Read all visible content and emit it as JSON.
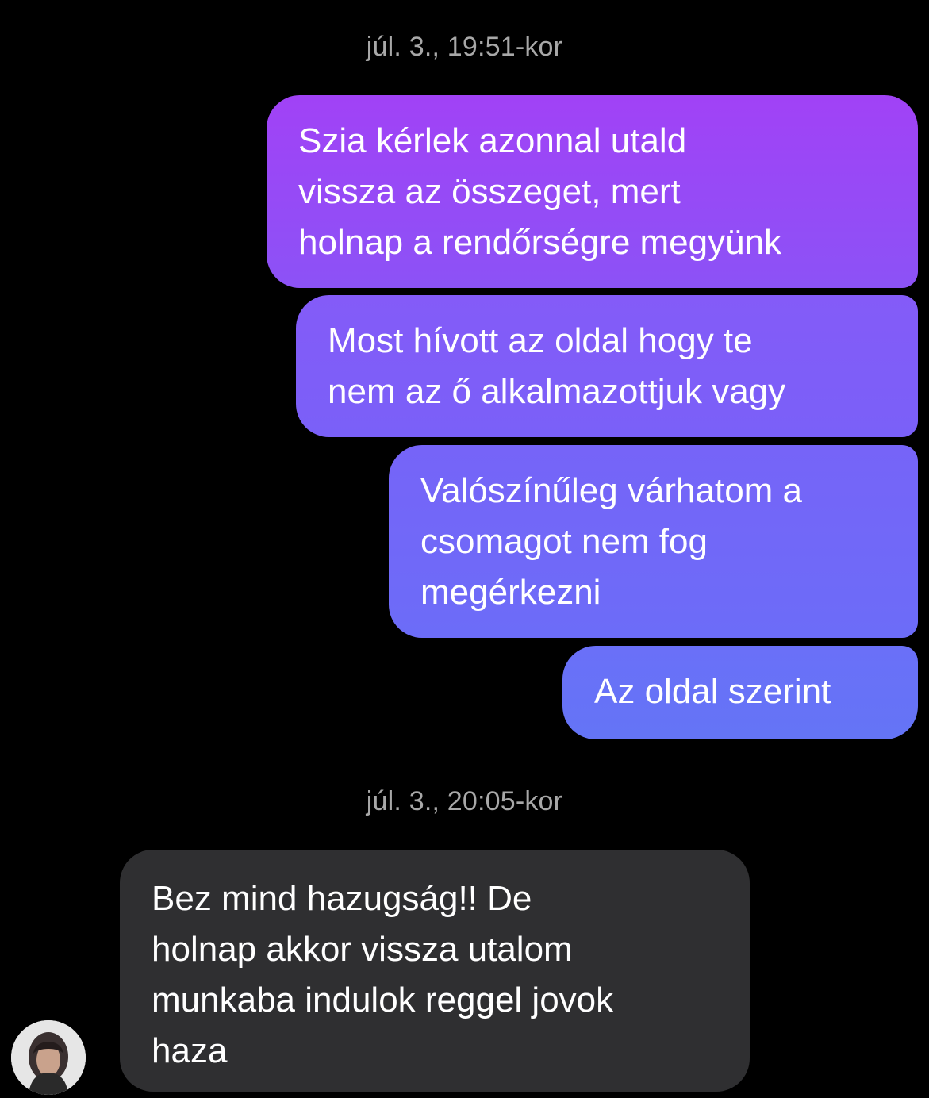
{
  "conversation": {
    "timestamps": [
      "júl. 3., 19:51-kor",
      "júl. 3., 20:05-kor"
    ],
    "outgoing_messages": [
      "Szia kérlek azonnal utald\nvissza az összeget, mert\nholnap a rendőrségre megyünk",
      "Most hívott az oldal hogy te\nnem az ő alkalmazottjuk vagy",
      "Valószínűleg várhatom a\ncsomagot nem fog\nmegérkezni",
      "Az oldal szerint"
    ],
    "incoming_messages": [
      "Bez mind hazugság!! De\nholnap akkor vissza utalom\nmunkaba indulok reggel jovok\nhaza"
    ]
  },
  "colors": {
    "background": "#000000",
    "outgoing_top": "#a142f6",
    "outgoing_bottom": "#6474f6",
    "incoming_bubble": "#2f2f31",
    "timestamp_text": "#a8a8a8"
  },
  "icons": {
    "contact_avatar": "avatar"
  }
}
